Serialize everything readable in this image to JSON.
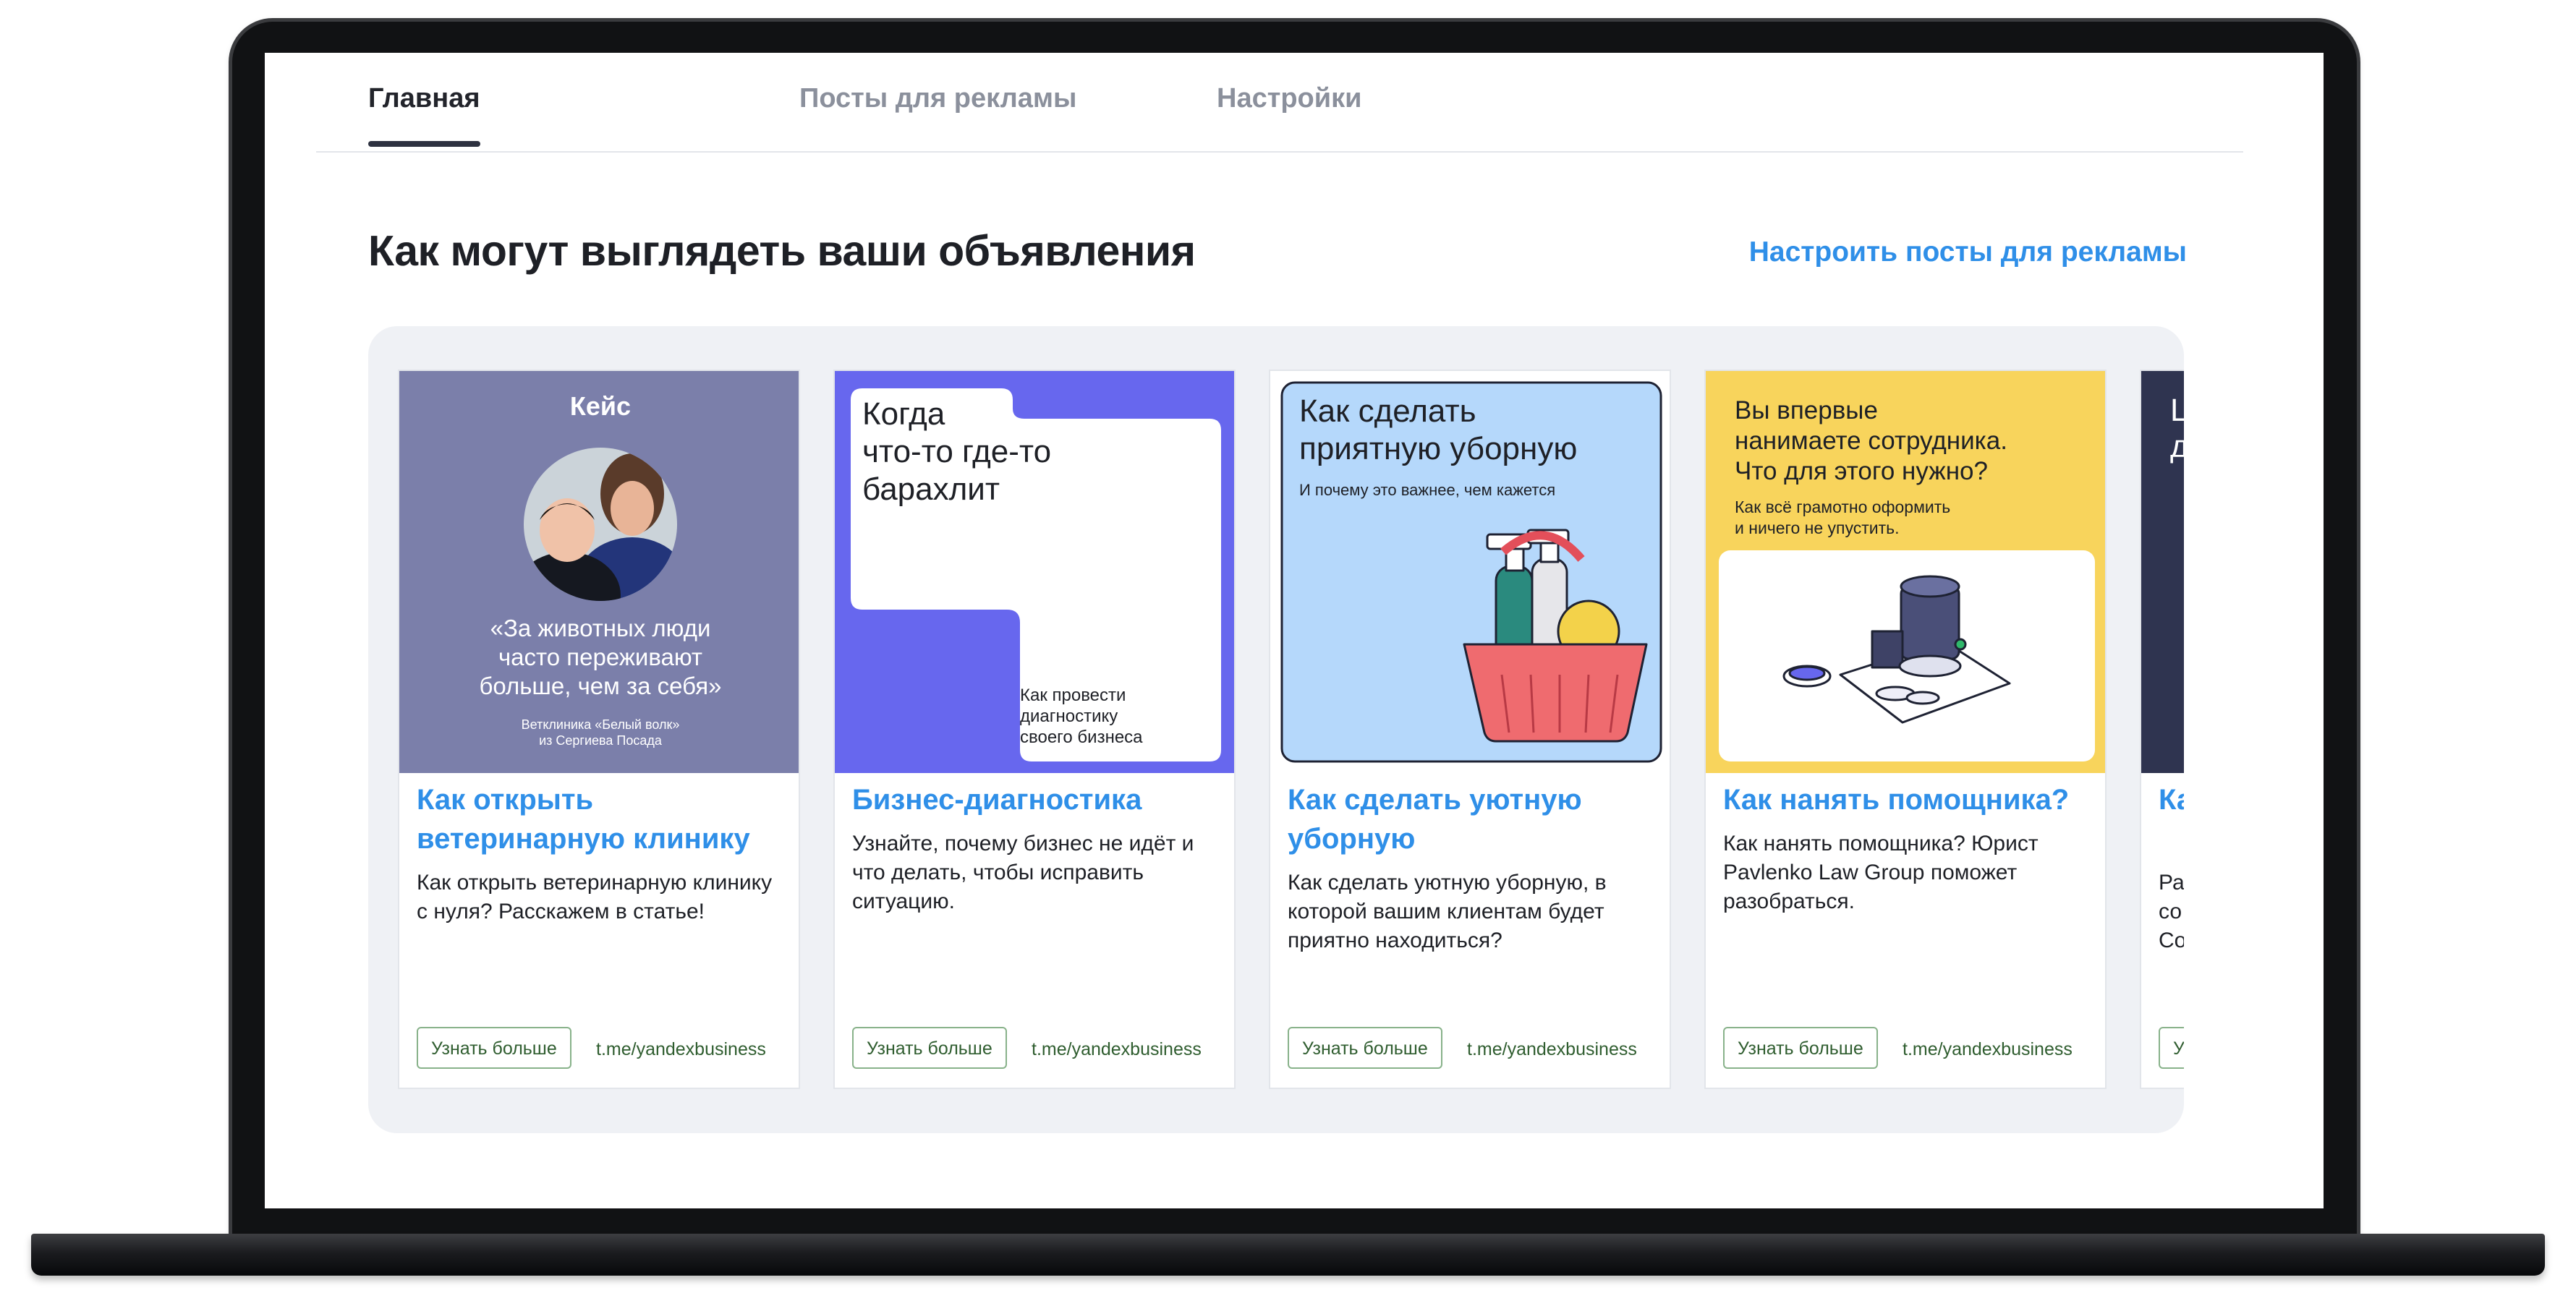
{
  "tabs": [
    {
      "label": "Главная",
      "active": true
    },
    {
      "label": "Посты для рекламы",
      "active": false
    },
    {
      "label": "Настройки",
      "active": false
    }
  ],
  "headline": "Как могут выглядеть ваши объявления",
  "setup_link": "Настроить посты для рекламы",
  "cards": [
    {
      "image": {
        "badge": "Кейс",
        "quote_lines": [
          "«За животных люди",
          "часто переживают",
          "больше, чем за себя»"
        ],
        "caption_lines": [
          "Ветклиника «Белый волк»",
          "из Сергиева Посада"
        ]
      },
      "title": "Как открыть ветеринарную клинику",
      "description": "Как открыть ветеринарную клинику с нуля? Расскажем в статье!",
      "button": "Узнать больше",
      "link": "t.me/yandexbusiness"
    },
    {
      "image": {
        "heading_lines": [
          "Когда",
          "что-то где-то",
          "барахлит"
        ],
        "caption_lines": [
          "Как провести",
          "диагностику",
          "своего бизнеса"
        ]
      },
      "title": "Бизнес-диагностика",
      "description": "Узнайте, почему бизнес не идёт и что делать, чтобы исправить ситуацию.",
      "button": "Узнать больше",
      "link": "t.me/yandexbusiness"
    },
    {
      "image": {
        "heading_lines": [
          "Как сделать",
          "приятную уборную"
        ],
        "subheading": "И почему это важнее, чем кажется"
      },
      "title": "Как сделать уютную уборную",
      "description": "Как сделать уютную уборную, в которой вашим клиентам будет приятно находиться?",
      "button": "Узнать больше",
      "link": "t.me/yandexbusiness"
    },
    {
      "image": {
        "heading_lines": [
          "Вы впервые",
          "нанимаете сотрудника.",
          "Что для этого нужно?"
        ],
        "subheading_lines": [
          "Как всё грамотно оформить",
          "и ничего не упустить."
        ]
      },
      "title": "Как нанять помощника?",
      "description": "Как нанять помощника? Юрист Pavlenko Law Group поможет разобраться.",
      "button": "Узнать больше",
      "link": "t.me/yandexbusiness"
    },
    {
      "image": {
        "heading_lines": [
          "Ц",
          "д"
        ]
      },
      "title": "Ка до",
      "description_lines": [
        "Ра",
        "со",
        "Co"
      ],
      "button": "У",
      "link": ""
    }
  ],
  "colors": {
    "accent_blue": "#2f8fe8",
    "card1_bg": "#7b7faa",
    "card2_bg": "#6767ee",
    "card3_bg": "#b5d8fb",
    "card4_bg": "#f8d45c",
    "card5_bg": "#2f3450",
    "button_green": "#2f5d2f"
  },
  "icons": {
    "next": "chevron-right-icon"
  }
}
